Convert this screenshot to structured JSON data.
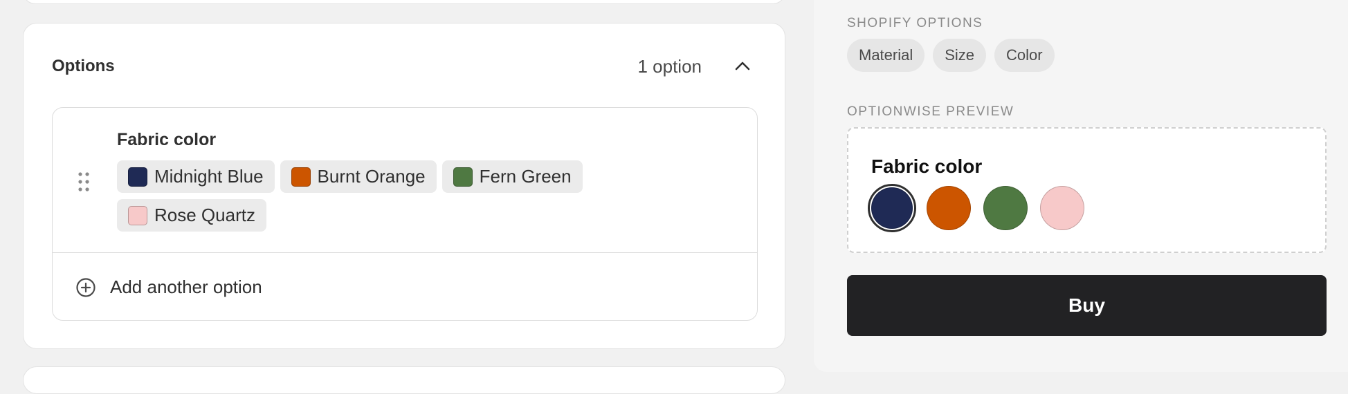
{
  "options_card": {
    "title": "Options",
    "count_label": "1 option",
    "option": {
      "name": "Fabric color",
      "values": [
        {
          "label": "Midnight Blue",
          "color": "#1f2a55"
        },
        {
          "label": "Burnt Orange",
          "color": "#cc5500"
        },
        {
          "label": "Fern Green",
          "color": "#4f7942"
        },
        {
          "label": "Rose Quartz",
          "color": "#f7c9c9"
        }
      ]
    },
    "add_label": "Add another option"
  },
  "sidebar": {
    "shopify_options_label": "SHOPIFY OPTIONS",
    "shopify_options": [
      "Material",
      "Size",
      "Color"
    ],
    "preview_label": "OPTIONWISE PREVIEW",
    "preview": {
      "title": "Fabric color",
      "selected_index": 0,
      "swatches": [
        {
          "name": "Midnight Blue",
          "color": "#1f2a55"
        },
        {
          "name": "Burnt Orange",
          "color": "#cc5500"
        },
        {
          "name": "Fern Green",
          "color": "#4f7942"
        },
        {
          "name": "Rose Quartz",
          "color": "#f7c9c9"
        }
      ]
    },
    "buy_label": "Buy"
  }
}
